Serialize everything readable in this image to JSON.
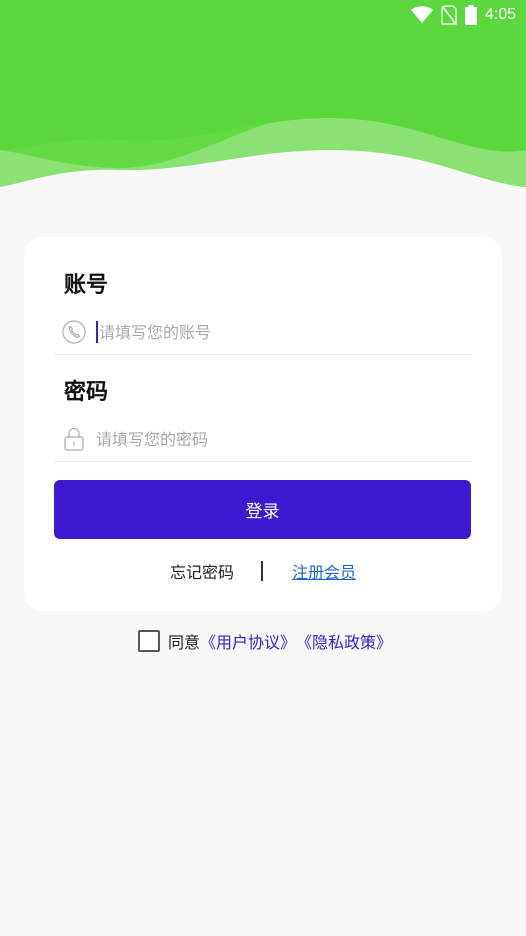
{
  "status_bar": {
    "time": "4:05",
    "icons": [
      "wifi-icon",
      "no-sim-icon",
      "battery-icon"
    ]
  },
  "colors": {
    "header_green": "#5cd83e",
    "button_purple": "#3b1ad1",
    "link_blue": "#1e63d6"
  },
  "form": {
    "account_label": "账号",
    "account_placeholder": "请填写您的账号",
    "account_icon": "phone-icon",
    "password_label": "密码",
    "password_placeholder": "请填写您的密码",
    "password_icon": "lock-icon",
    "login_button": "登录",
    "forgot_password": "忘记密码",
    "register": "注册会员"
  },
  "agreement": {
    "checked": false,
    "prefix": "同意",
    "user_agreement": "《用户协议》",
    "privacy_policy": "《隐私政策》"
  }
}
